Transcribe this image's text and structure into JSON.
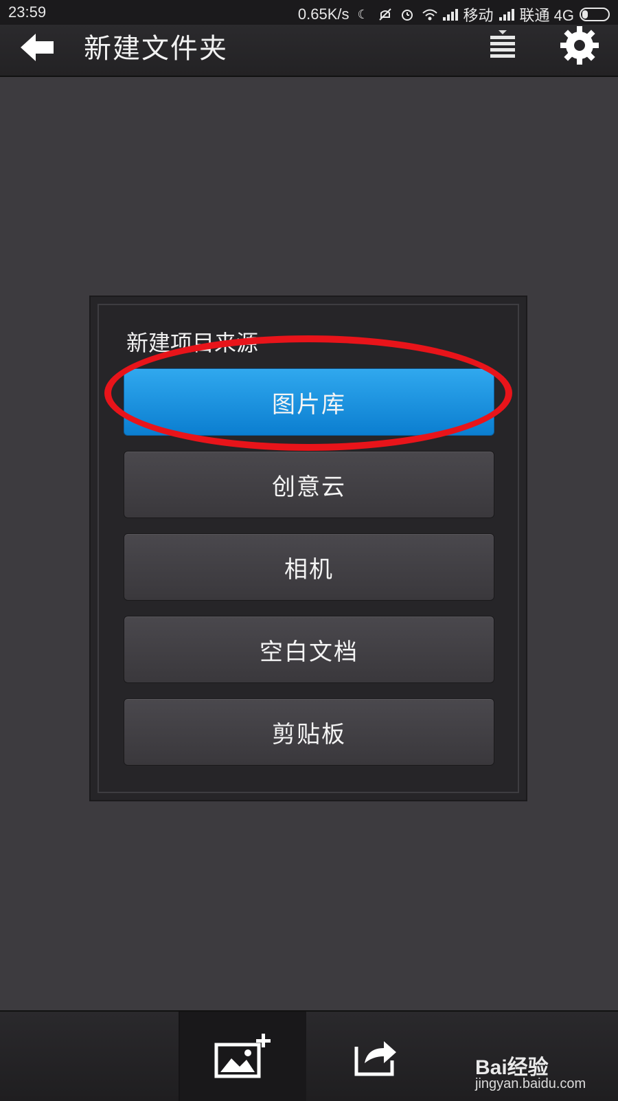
{
  "status_bar": {
    "time": "23:59",
    "speed": "0.65K/s",
    "carrier1": "移动",
    "carrier2": "联通 4G",
    "icons": [
      "moon-icon",
      "mute-icon",
      "alarm-icon",
      "wifi-icon",
      "signal-icon",
      "signal-icon",
      "battery-icon"
    ]
  },
  "header": {
    "title": "新建文件夹",
    "back_icon": "back-arrow-icon",
    "menu_icon": "menu-icon",
    "settings_icon": "gear-icon"
  },
  "dialog": {
    "title": "新建项目来源",
    "options": [
      {
        "label": "图片库",
        "selected": true
      },
      {
        "label": "创意云",
        "selected": false
      },
      {
        "label": "相机",
        "selected": false
      },
      {
        "label": "空白文档",
        "selected": false
      },
      {
        "label": "剪贴板",
        "selected": false
      }
    ]
  },
  "toolbar": {
    "items": [
      "add-image-icon",
      "share-icon"
    ]
  },
  "watermark": {
    "logo_text": "Bai经验",
    "url": "jingyan.baidu.com"
  },
  "colors": {
    "accent": "#1e93e0",
    "highlight": "#e8141a",
    "background": "#3d3b3f"
  }
}
